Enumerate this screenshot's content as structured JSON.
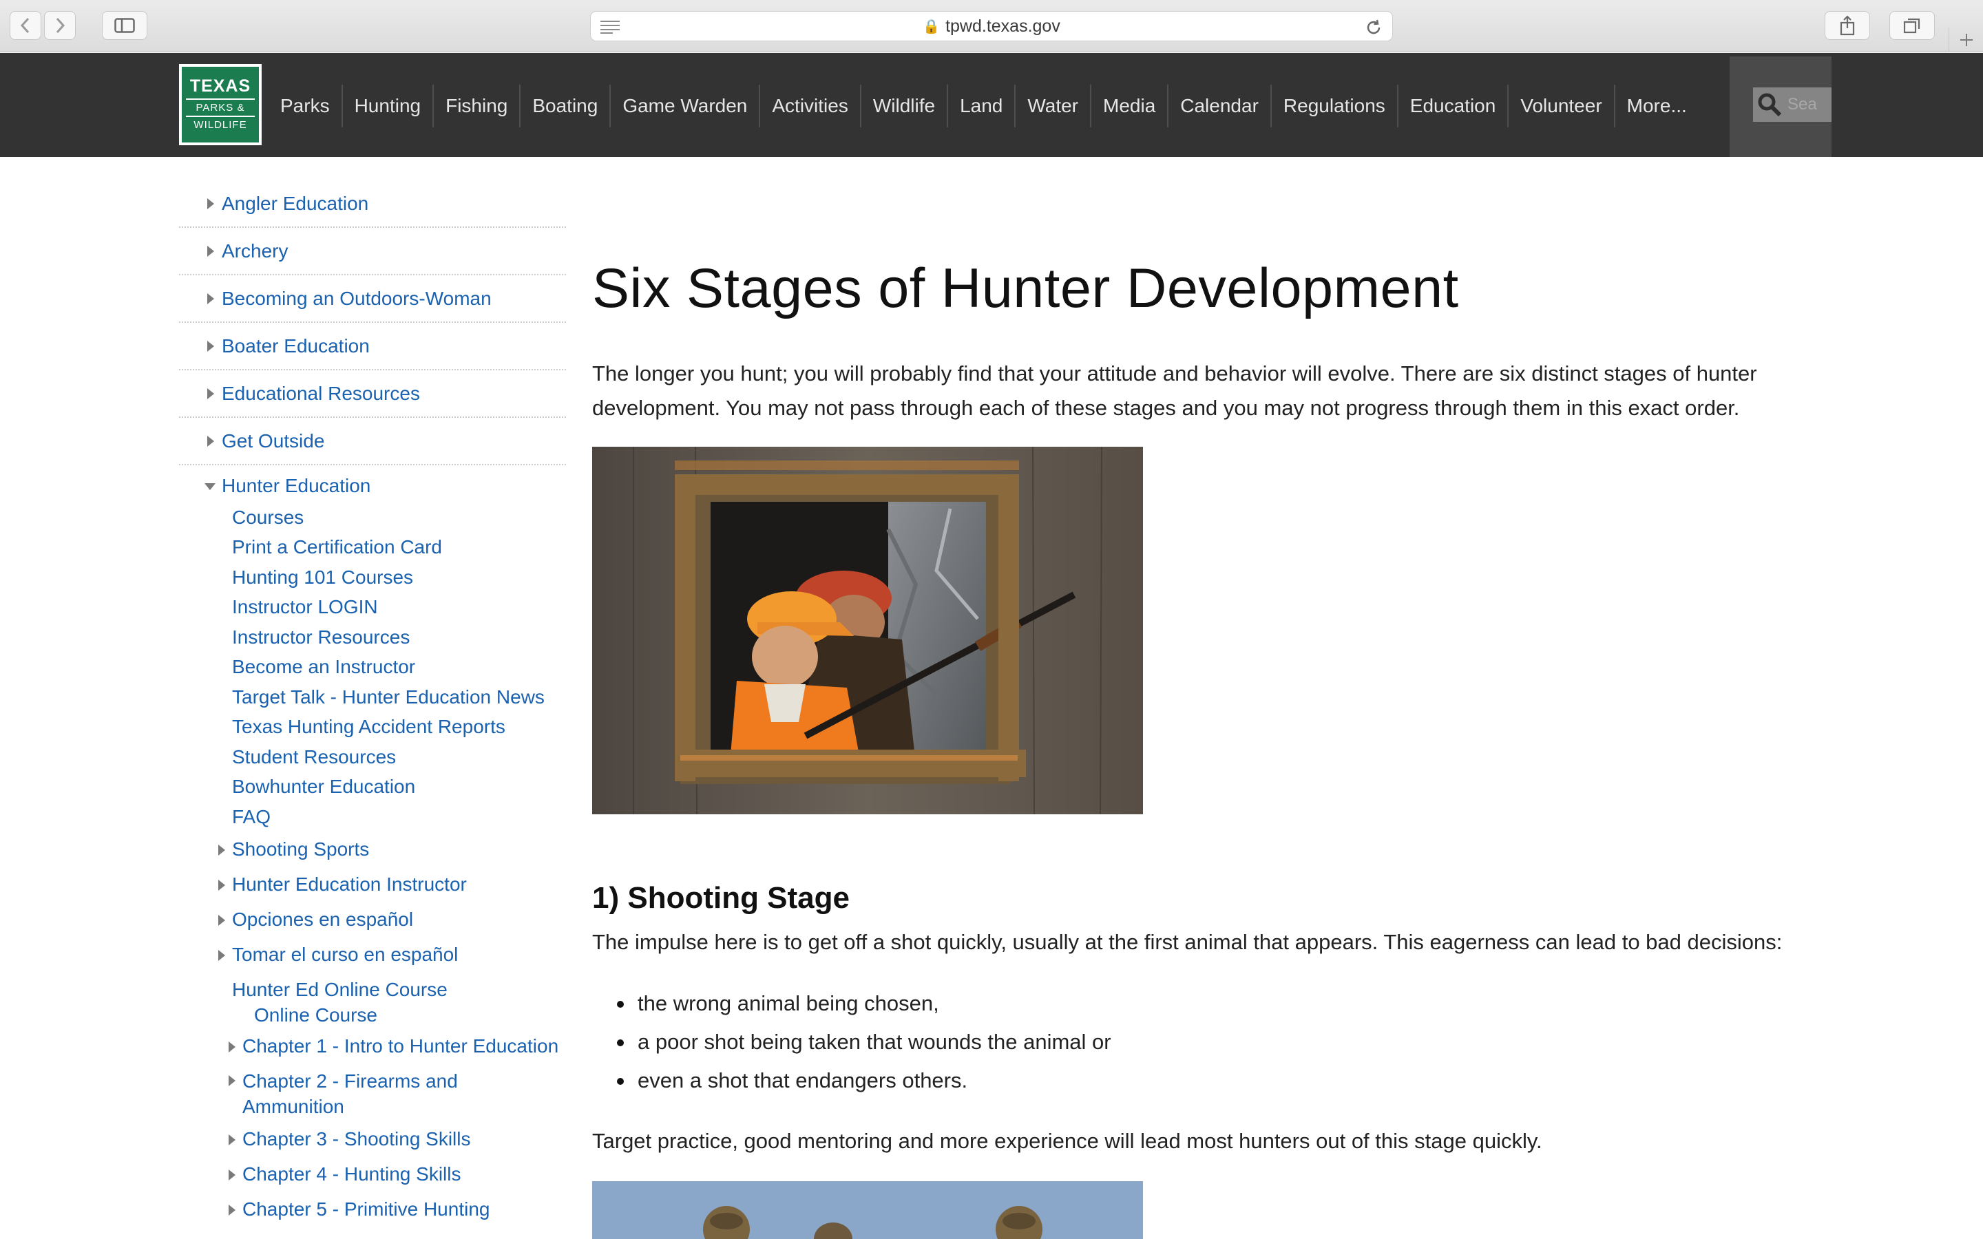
{
  "browser": {
    "url": "tpwd.texas.gov"
  },
  "logo": {
    "line1": "TEXAS",
    "line2": "PARKS &",
    "line3": "WILDLIFE"
  },
  "nav": [
    "Parks",
    "Hunting",
    "Fishing",
    "Boating",
    "Game Warden",
    "Activities",
    "Wildlife",
    "Land",
    "Water",
    "Media",
    "Calendar",
    "Regulations",
    "Education",
    "Volunteer",
    "More..."
  ],
  "search": {
    "placeholder": "Sea"
  },
  "sidebar": {
    "top_items": [
      "Angler Education",
      "Archery",
      "Becoming an Outdoors-Woman",
      "Boater Education",
      "Educational Resources",
      "Get Outside"
    ],
    "open_section": "Hunter Education",
    "sub_items": [
      "Courses",
      "Print a Certification Card",
      "Hunting 101 Courses",
      "Instructor LOGIN",
      "Instructor Resources",
      "Become an Instructor",
      "Target Talk - Hunter Education News",
      "Texas Hunting Accident Reports",
      "Student Resources",
      "Bowhunter Education",
      "FAQ"
    ],
    "collapsible_items": [
      "Shooting Sports",
      "Hunter Education Instructor",
      "Opciones en español",
      "Tomar el curso en español"
    ],
    "online_course_line1": "Hunter Ed Online Course",
    "online_course_line2": "Online Course",
    "chapters": [
      "Chapter 1 - Intro to Hunter Education",
      "Chapter 2 - Firearms and",
      "Ammunition",
      "Chapter 3 - Shooting Skills",
      "Chapter 4 - Hunting Skills",
      "Chapter 5 - Primitive Hunting"
    ]
  },
  "main": {
    "title": "Six Stages of Hunter Development",
    "intro_line1": "The longer you hunt; you will probably find that your attitude and behavior will evolve. There are six distinct stages of hunter",
    "intro_line2": "development. You may not pass through each of these stages and you may not progress through them in this exact order.",
    "section1_heading": "1) Shooting Stage",
    "section1_text": "The impulse here is to get off a shot quickly, usually at the first animal that appears. This eagerness can lead to bad decisions:",
    "bullets": [
      " the wrong animal being chosen,",
      "a poor shot being taken that wounds the animal or",
      "even a shot that endangers others."
    ],
    "closing": "Target practice, good mentoring and more experience will lead most hunters out of this stage quickly."
  }
}
